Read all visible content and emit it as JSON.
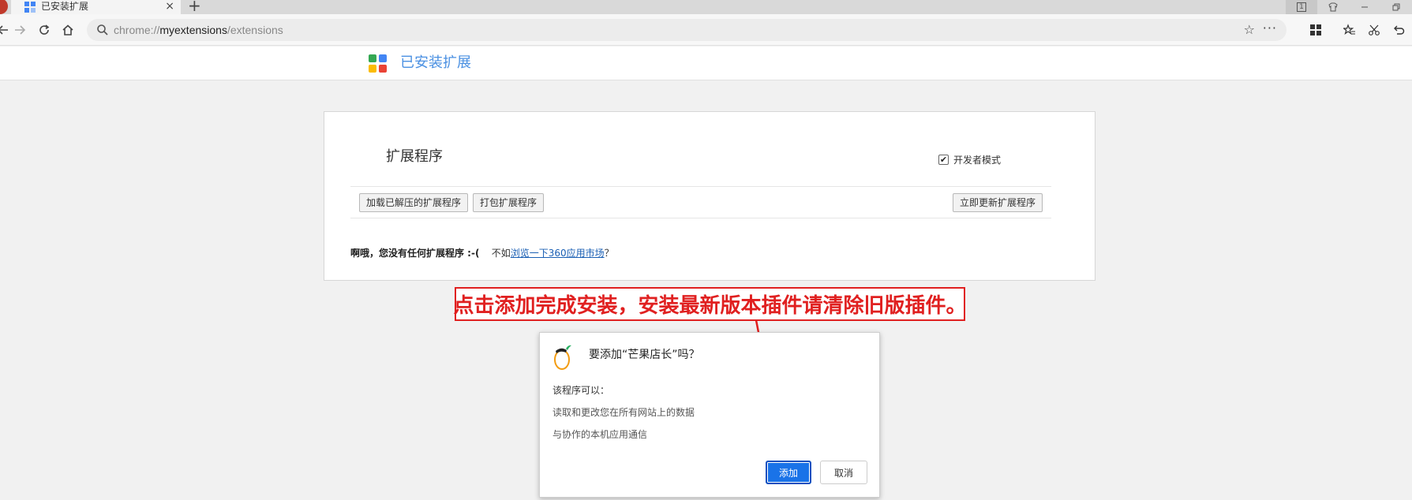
{
  "browser": {
    "tab": {
      "title": "已安装扩展",
      "close": "×"
    },
    "new_tab": "+",
    "window_badge": "1",
    "address": {
      "scheme": "chrome://",
      "host": "myextensions",
      "path": "/extensions"
    },
    "menu_dots": "···"
  },
  "page": {
    "title": "已安装扩展",
    "logo_colors": [
      "#34a853",
      "#4285f4",
      "#fbbc05",
      "#ea4335"
    ]
  },
  "extensions": {
    "heading": "扩展程序",
    "dev_mode_label": "开发者模式",
    "dev_mode_checked": true,
    "buttons": {
      "load_unpacked": "加载已解压的扩展程序",
      "pack": "打包扩展程序",
      "update_now": "立即更新扩展程序"
    },
    "empty_message_bold": "啊哦，您没有任何扩展程序 :-(",
    "empty_message_mid": "不如",
    "empty_link": "浏览一下360应用市场",
    "empty_message_end": "？"
  },
  "annotation": {
    "text": "点击添加完成安装，安装最新版本插件请清除旧版插件。",
    "color": "#e02020"
  },
  "dialog": {
    "title": "要添加“芒果店长”吗？",
    "permissions_heading": "该程序可以：",
    "permissions": [
      "读取和更改您在所有网站上的数据",
      "与协作的本机应用通信"
    ],
    "add_label": "添加",
    "cancel_label": "取消",
    "accent": "#1a73e8"
  }
}
